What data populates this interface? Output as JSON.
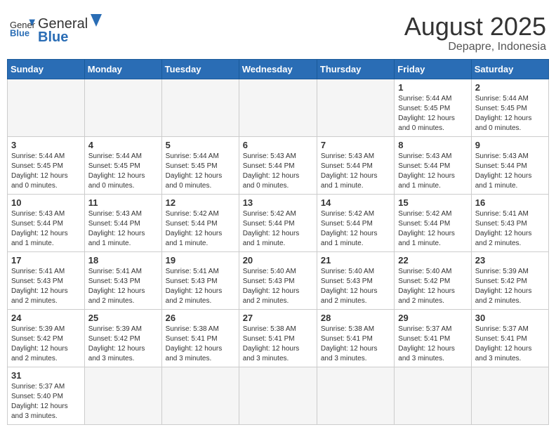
{
  "header": {
    "logo_general": "General",
    "logo_blue": "Blue",
    "month_year": "August 2025",
    "location": "Depapre, Indonesia"
  },
  "weekdays": [
    "Sunday",
    "Monday",
    "Tuesday",
    "Wednesday",
    "Thursday",
    "Friday",
    "Saturday"
  ],
  "weeks": [
    [
      {
        "day": "",
        "content": ""
      },
      {
        "day": "",
        "content": ""
      },
      {
        "day": "",
        "content": ""
      },
      {
        "day": "",
        "content": ""
      },
      {
        "day": "",
        "content": ""
      },
      {
        "day": "1",
        "content": "Sunrise: 5:44 AM\nSunset: 5:45 PM\nDaylight: 12 hours\nand 0 minutes."
      },
      {
        "day": "2",
        "content": "Sunrise: 5:44 AM\nSunset: 5:45 PM\nDaylight: 12 hours\nand 0 minutes."
      }
    ],
    [
      {
        "day": "3",
        "content": "Sunrise: 5:44 AM\nSunset: 5:45 PM\nDaylight: 12 hours\nand 0 minutes."
      },
      {
        "day": "4",
        "content": "Sunrise: 5:44 AM\nSunset: 5:45 PM\nDaylight: 12 hours\nand 0 minutes."
      },
      {
        "day": "5",
        "content": "Sunrise: 5:44 AM\nSunset: 5:45 PM\nDaylight: 12 hours\nand 0 minutes."
      },
      {
        "day": "6",
        "content": "Sunrise: 5:43 AM\nSunset: 5:44 PM\nDaylight: 12 hours\nand 0 minutes."
      },
      {
        "day": "7",
        "content": "Sunrise: 5:43 AM\nSunset: 5:44 PM\nDaylight: 12 hours\nand 1 minute."
      },
      {
        "day": "8",
        "content": "Sunrise: 5:43 AM\nSunset: 5:44 PM\nDaylight: 12 hours\nand 1 minute."
      },
      {
        "day": "9",
        "content": "Sunrise: 5:43 AM\nSunset: 5:44 PM\nDaylight: 12 hours\nand 1 minute."
      }
    ],
    [
      {
        "day": "10",
        "content": "Sunrise: 5:43 AM\nSunset: 5:44 PM\nDaylight: 12 hours\nand 1 minute."
      },
      {
        "day": "11",
        "content": "Sunrise: 5:43 AM\nSunset: 5:44 PM\nDaylight: 12 hours\nand 1 minute."
      },
      {
        "day": "12",
        "content": "Sunrise: 5:42 AM\nSunset: 5:44 PM\nDaylight: 12 hours\nand 1 minute."
      },
      {
        "day": "13",
        "content": "Sunrise: 5:42 AM\nSunset: 5:44 PM\nDaylight: 12 hours\nand 1 minute."
      },
      {
        "day": "14",
        "content": "Sunrise: 5:42 AM\nSunset: 5:44 PM\nDaylight: 12 hours\nand 1 minute."
      },
      {
        "day": "15",
        "content": "Sunrise: 5:42 AM\nSunset: 5:44 PM\nDaylight: 12 hours\nand 1 minute."
      },
      {
        "day": "16",
        "content": "Sunrise: 5:41 AM\nSunset: 5:43 PM\nDaylight: 12 hours\nand 2 minutes."
      }
    ],
    [
      {
        "day": "17",
        "content": "Sunrise: 5:41 AM\nSunset: 5:43 PM\nDaylight: 12 hours\nand 2 minutes."
      },
      {
        "day": "18",
        "content": "Sunrise: 5:41 AM\nSunset: 5:43 PM\nDaylight: 12 hours\nand 2 minutes."
      },
      {
        "day": "19",
        "content": "Sunrise: 5:41 AM\nSunset: 5:43 PM\nDaylight: 12 hours\nand 2 minutes."
      },
      {
        "day": "20",
        "content": "Sunrise: 5:40 AM\nSunset: 5:43 PM\nDaylight: 12 hours\nand 2 minutes."
      },
      {
        "day": "21",
        "content": "Sunrise: 5:40 AM\nSunset: 5:43 PM\nDaylight: 12 hours\nand 2 minutes."
      },
      {
        "day": "22",
        "content": "Sunrise: 5:40 AM\nSunset: 5:42 PM\nDaylight: 12 hours\nand 2 minutes."
      },
      {
        "day": "23",
        "content": "Sunrise: 5:39 AM\nSunset: 5:42 PM\nDaylight: 12 hours\nand 2 minutes."
      }
    ],
    [
      {
        "day": "24",
        "content": "Sunrise: 5:39 AM\nSunset: 5:42 PM\nDaylight: 12 hours\nand 2 minutes."
      },
      {
        "day": "25",
        "content": "Sunrise: 5:39 AM\nSunset: 5:42 PM\nDaylight: 12 hours\nand 3 minutes."
      },
      {
        "day": "26",
        "content": "Sunrise: 5:38 AM\nSunset: 5:41 PM\nDaylight: 12 hours\nand 3 minutes."
      },
      {
        "day": "27",
        "content": "Sunrise: 5:38 AM\nSunset: 5:41 PM\nDaylight: 12 hours\nand 3 minutes."
      },
      {
        "day": "28",
        "content": "Sunrise: 5:38 AM\nSunset: 5:41 PM\nDaylight: 12 hours\nand 3 minutes."
      },
      {
        "day": "29",
        "content": "Sunrise: 5:37 AM\nSunset: 5:41 PM\nDaylight: 12 hours\nand 3 minutes."
      },
      {
        "day": "30",
        "content": "Sunrise: 5:37 AM\nSunset: 5:41 PM\nDaylight: 12 hours\nand 3 minutes."
      }
    ],
    [
      {
        "day": "31",
        "content": "Sunrise: 5:37 AM\nSunset: 5:40 PM\nDaylight: 12 hours\nand 3 minutes."
      },
      {
        "day": "",
        "content": ""
      },
      {
        "day": "",
        "content": ""
      },
      {
        "day": "",
        "content": ""
      },
      {
        "day": "",
        "content": ""
      },
      {
        "day": "",
        "content": ""
      },
      {
        "day": "",
        "content": ""
      }
    ]
  ]
}
